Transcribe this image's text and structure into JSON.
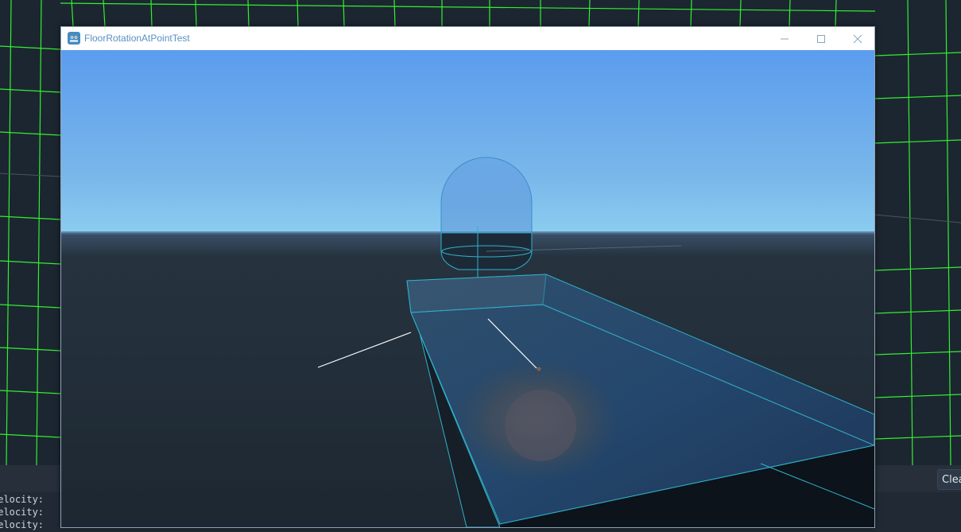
{
  "window": {
    "title": "FloorRotationAtPointTest",
    "icon": "godot-icon",
    "controls": {
      "minimize": "minimize-icon",
      "maximize": "maximize-icon",
      "close": "close-icon"
    }
  },
  "console": {
    "clear_label": "Clear",
    "lines": [
      "velocity:",
      "velocity:",
      "velocity:"
    ]
  },
  "colors": {
    "grid": "#33ff33",
    "sky_top": "#5b9ced",
    "sky_horizon": "#86c7ee",
    "ground": "#1e2933",
    "wireframe": "#2fb3cc",
    "title_text": "#5a8fc4"
  }
}
